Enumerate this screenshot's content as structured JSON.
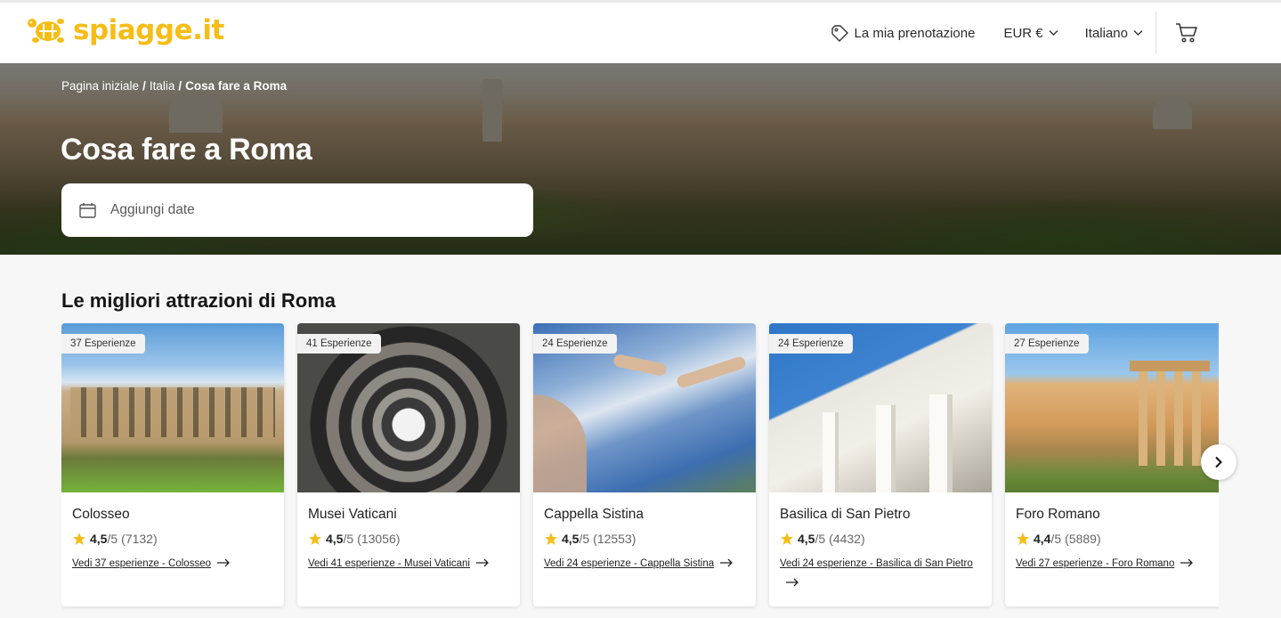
{
  "brand": {
    "logo_text": "spiagge.it",
    "color": "#f6bd16"
  },
  "nav": {
    "booking_label": "La mia prenotazione",
    "currency_label": "EUR €",
    "language_label": "Italiano"
  },
  "breadcrumb": {
    "home": "Pagina iniziale",
    "country": "Italia",
    "current": "Cosa fare a Roma",
    "separator": "/"
  },
  "hero": {
    "title": "Cosa fare a Roma",
    "date_placeholder": "Aggiungi date"
  },
  "attractions": {
    "title": "Le migliori attrazioni di Roma",
    "rating_color": "#f6bd16",
    "items": [
      {
        "badge": "37 Esperienze",
        "name": "Colosseo",
        "score": "4,5",
        "out_of": "/5",
        "count": "(7132)",
        "link": "Vedi 37 esperienze - Colosseo"
      },
      {
        "badge": "41 Esperienze",
        "name": "Musei Vaticani",
        "score": "4,5",
        "out_of": "/5",
        "count": "(13056)",
        "link": "Vedi 41 esperienze - Musei Vaticani"
      },
      {
        "badge": "24 Esperienze",
        "name": "Cappella Sistina",
        "score": "4,5",
        "out_of": "/5",
        "count": "(12553)",
        "link": "Vedi 24 esperienze - Cappella Sistina"
      },
      {
        "badge": "24 Esperienze",
        "name": "Basilica di San Pietro",
        "score": "4,5",
        "out_of": "/5",
        "count": "(4432)",
        "link": "Vedi 24 esperienze - Basilica di San Pietro"
      },
      {
        "badge": "27 Esperienze",
        "name": "Foro Romano",
        "score": "4,4",
        "out_of": "/5",
        "count": "(5889)",
        "link": "Vedi 27 esperienze - Foro Romano"
      }
    ]
  }
}
